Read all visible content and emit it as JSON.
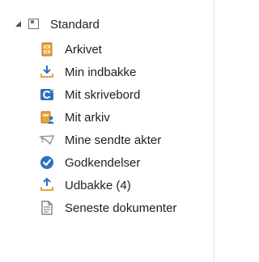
{
  "tree": {
    "root": {
      "label": "Standard",
      "expanded": true,
      "icon": "folder-square-icon"
    },
    "items": [
      {
        "label": "Arkivet",
        "icon": "archive-cabinet-icon"
      },
      {
        "label": "Min indbakke",
        "icon": "inbox-download-icon"
      },
      {
        "label": "Mit skrivebord",
        "icon": "desk-icon"
      },
      {
        "label": "Mit arkiv",
        "icon": "personal-archive-icon"
      },
      {
        "label": "Mine sendte akter",
        "icon": "sent-envelope-icon"
      },
      {
        "label": "Godkendelser",
        "icon": "approval-check-icon"
      },
      {
        "label": "Udbakke (4)",
        "icon": "outbox-upload-icon"
      },
      {
        "label": "Seneste dokumenter",
        "icon": "recent-document-icon"
      }
    ]
  },
  "colors": {
    "accent_blue": "#2f6fc0",
    "archive_orange": "#e8a33a",
    "text": "#1f1f1f"
  }
}
